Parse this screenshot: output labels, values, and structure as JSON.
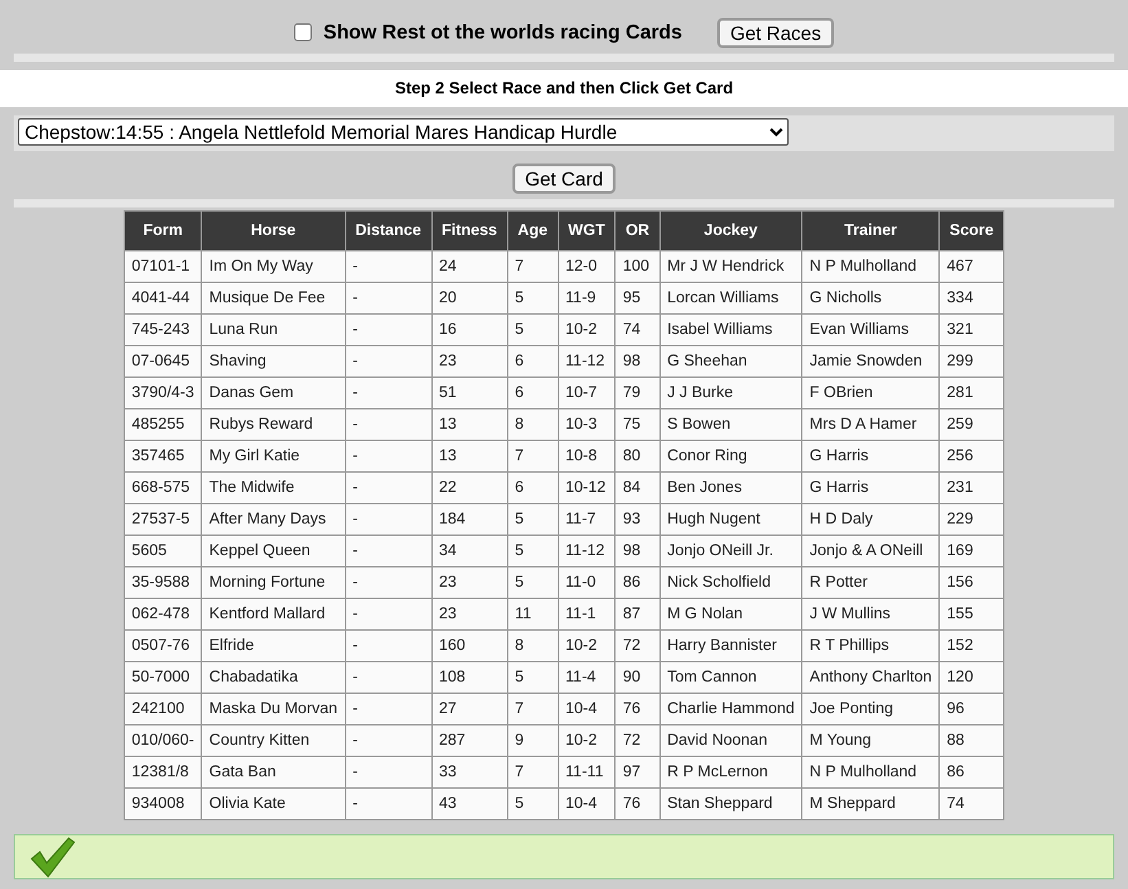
{
  "filter": {
    "label": "Show Rest ot the worlds racing Cards",
    "checked": false,
    "button": "Get Races"
  },
  "step": {
    "title": "Step 2 Select Race and then Click Get Card",
    "race": "Chepstow:14:55 : Angela Nettlefold Memorial Mares Handicap Hurdle",
    "button": "Get Card"
  },
  "table": {
    "columns": [
      "Form",
      "Horse",
      "Distance",
      "Fitness",
      "Age",
      "WGT",
      "OR",
      "Jockey",
      "Trainer",
      "Score"
    ],
    "rows": [
      [
        "07101-1",
        "Im On My Way",
        "-",
        "24",
        "7",
        "12-0",
        "100",
        "Mr J W Hendrick",
        "N P Mulholland",
        "467"
      ],
      [
        "4041-44",
        "Musique De Fee",
        "-",
        "20",
        "5",
        "11-9",
        "95",
        "Lorcan Williams",
        "G Nicholls",
        "334"
      ],
      [
        "745-243",
        "Luna Run",
        "-",
        "16",
        "5",
        "10-2",
        "74",
        "Isabel Williams",
        "Evan Williams",
        "321"
      ],
      [
        "07-0645",
        "Shaving",
        "-",
        "23",
        "6",
        "11-12",
        "98",
        "G Sheehan",
        "Jamie Snowden",
        "299"
      ],
      [
        "3790/4-3",
        "Danas Gem",
        "-",
        "51",
        "6",
        "10-7",
        "79",
        "J J Burke",
        "F OBrien",
        "281"
      ],
      [
        "485255",
        "Rubys Reward",
        "-",
        "13",
        "8",
        "10-3",
        "75",
        "S Bowen",
        "Mrs D A Hamer",
        "259"
      ],
      [
        "357465",
        "My Girl Katie",
        "-",
        "13",
        "7",
        "10-8",
        "80",
        "Conor Ring",
        "G Harris",
        "256"
      ],
      [
        "668-575",
        "The Midwife",
        "-",
        "22",
        "6",
        "10-12",
        "84",
        "Ben Jones",
        "G Harris",
        "231"
      ],
      [
        "27537-5",
        "After Many Days",
        "-",
        "184",
        "5",
        "11-7",
        "93",
        "Hugh Nugent",
        "H D Daly",
        "229"
      ],
      [
        "5605",
        "Keppel Queen",
        "-",
        "34",
        "5",
        "11-12",
        "98",
        "Jonjo ONeill Jr.",
        "Jonjo & A ONeill",
        "169"
      ],
      [
        "35-9588",
        "Morning Fortune",
        "-",
        "23",
        "5",
        "11-0",
        "86",
        "Nick Scholfield",
        "R Potter",
        "156"
      ],
      [
        "062-478",
        "Kentford Mallard",
        "-",
        "23",
        "11",
        "11-1",
        "87",
        "M G Nolan",
        "J W Mullins",
        "155"
      ],
      [
        "0507-76",
        "Elfride",
        "-",
        "160",
        "8",
        "10-2",
        "72",
        "Harry Bannister",
        "R T Phillips",
        "152"
      ],
      [
        "50-7000",
        "Chabadatika",
        "-",
        "108",
        "5",
        "11-4",
        "90",
        "Tom Cannon",
        "Anthony Charlton",
        "120"
      ],
      [
        "242100",
        "Maska Du Morvan",
        "-",
        "27",
        "7",
        "10-4",
        "76",
        "Charlie Hammond",
        "Joe Ponting",
        "96"
      ],
      [
        "010/060-",
        "Country Kitten",
        "-",
        "287",
        "9",
        "10-2",
        "72",
        "David Noonan",
        "M Young",
        "88"
      ],
      [
        "12381/8",
        "Gata Ban",
        "-",
        "33",
        "7",
        "11-11",
        "97",
        "R P McLernon",
        "N P Mulholland",
        "86"
      ],
      [
        "934008",
        "Olivia Kate",
        "-",
        "43",
        "5",
        "10-4",
        "76",
        "Stan Sheppard",
        "M Sheppard",
        "74"
      ]
    ]
  },
  "status": {
    "ok": true
  }
}
